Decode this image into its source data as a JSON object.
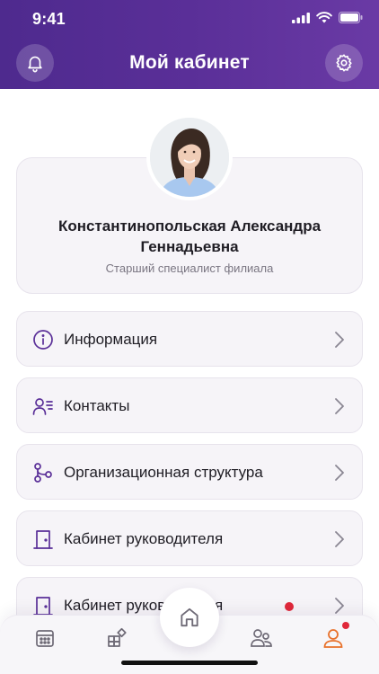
{
  "status_bar": {
    "time": "9:41"
  },
  "header": {
    "title": "Мой кабинет"
  },
  "profile": {
    "name": "Константинопольская Александра Геннадьевна",
    "role": "Старший специалист филиала"
  },
  "menu": [
    {
      "label": "Информация",
      "icon": "info-icon"
    },
    {
      "label": "Контакты",
      "icon": "contacts-icon"
    },
    {
      "label": "Организационная структура",
      "icon": "org-structure-icon"
    },
    {
      "label": "Кабинет руководителя",
      "icon": "door-icon"
    },
    {
      "label": "Кабинет руководителя",
      "icon": "door-icon",
      "has_notification": true
    }
  ],
  "colors": {
    "accent": "#5a2f98",
    "active_tab": "#e8712b",
    "notification": "#e0283a"
  },
  "bottom_nav": [
    {
      "icon": "calendar-icon"
    },
    {
      "icon": "widgets-icon"
    },
    {
      "icon": "home-icon"
    },
    {
      "icon": "team-icon"
    },
    {
      "icon": "profile-icon",
      "active": true
    }
  ]
}
